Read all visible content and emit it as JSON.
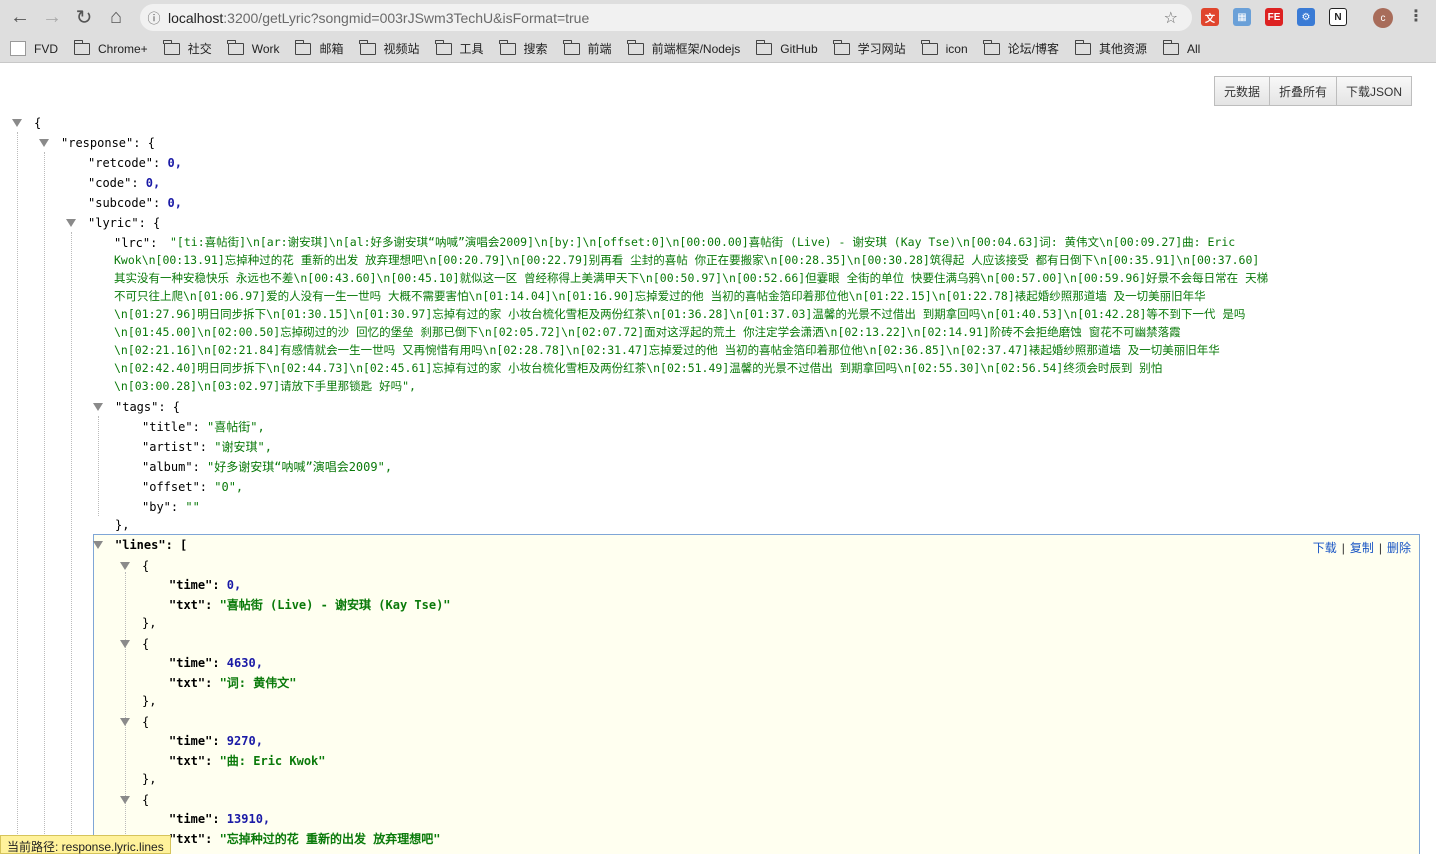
{
  "browser": {
    "url_host": "localhost",
    "url_path": ":3200/getLyric?songmid=003rJSwm3TechU&isFormat=true",
    "avatar_letter": "c"
  },
  "bookmarks": [
    "FVD",
    "Chrome+",
    "社交",
    "Work",
    "邮箱",
    "视频站",
    "工具",
    "搜索",
    "前端",
    "前端框架/Nodejs",
    "GitHub",
    "学习网站",
    "icon",
    "论坛/博客",
    "其他资源",
    "All"
  ],
  "viewer_buttons": [
    "元数据",
    "折叠所有",
    "下载JSON"
  ],
  "json": {
    "open_brace": "{",
    "response_key": "\"response\": {",
    "retcode_key": "\"retcode\": ",
    "retcode_val": "0,",
    "code_key": "\"code\": ",
    "code_val": "0,",
    "subcode_key": "\"subcode\": ",
    "subcode_val": "0,",
    "lyric_key": "\"lyric\": {",
    "lrc_key": "\"lrc\": ",
    "lrc_lines": [
      "\"[ti:喜帖街]\\n[ar:谢安琪]\\n[al:好多谢安琪“呐喊”演唱会2009]\\n[by:]\\n[offset:0]\\n[00:00.00]喜帖街 (Live) - 谢安琪 (Kay Tse)\\n[00:04.63]词: 黄伟文\\n[00:09.27]曲: Eric",
      "Kwok\\n[00:13.91]忘掉种过的花 重新的出发 放弃理想吧\\n[00:20.79]\\n[00:22.79]别再看 尘封的喜帖 你正在要搬家\\n[00:28.35]\\n[00:30.28]筑得起 人应该接受 都有日倒下\\n[00:35.91]\\n[00:37.60]",
      "其实没有一种安稳快乐 永远也不差\\n[00:43.60]\\n[00:45.10]就似这一区 曾经称得上美满甲天下\\n[00:50.97]\\n[00:52.66]但霎眼 全街的单位 快要住满乌鸦\\n[00:57.00]\\n[00:59.96]好景不会每日常在 天梯",
      "不可只往上爬\\n[01:06.97]爱的人没有一生一世吗 大概不需要害怕\\n[01:14.04]\\n[01:16.90]忘掉爱过的他 当初的喜帖金箔印着那位他\\n[01:22.15]\\n[01:22.78]裱起婚纱照那道墙 及一切美丽旧年华",
      "\\n[01:27.96]明日同步拆下\\n[01:30.15]\\n[01:30.97]忘掉有过的家 小妆台梳化雪柜及两份红茶\\n[01:36.28]\\n[01:37.03]温馨的光景不过借出 到期拿回吗\\n[01:40.53]\\n[01:42.28]等不到下一代 是吗",
      "\\n[01:45.00]\\n[02:00.50]忘掉砌过的沙 回忆的堡垒 刹那已倒下\\n[02:05.72]\\n[02:07.72]面对这浮起的荒土 你注定学会潇洒\\n[02:13.22]\\n[02:14.91]阶砖不会拒绝磨蚀 窗花不可幽禁落霞",
      "\\n[02:21.16]\\n[02:21.84]有感情就会一生一世吗 又再惋惜有用吗\\n[02:28.78]\\n[02:31.47]忘掉爱过的他 当初的喜帖金箔印着那位他\\n[02:36.85]\\n[02:37.47]裱起婚纱照那道墙 及一切美丽旧年华",
      "\\n[02:42.40]明日同步拆下\\n[02:44.73]\\n[02:45.61]忘掉有过的家 小妆台梳化雪柜及两份红茶\\n[02:51.49]温馨的光景不过借出 到期拿回吗\\n[02:55.30]\\n[02:56.54]终须会时辰到 别怕",
      "\\n[03:00.28]\\n[03:02.97]请放下手里那锁匙 好吗\","
    ],
    "tags_key": "\"tags\": {",
    "tags": [
      {
        "key": "\"title\": ",
        "val": "\"喜帖街\","
      },
      {
        "key": "\"artist\": ",
        "val": "\"谢安琪\","
      },
      {
        "key": "\"album\": ",
        "val": "\"好多谢安琪“呐喊”演唱会2009\","
      },
      {
        "key": "\"offset\": ",
        "val": "\"0\","
      },
      {
        "key": "\"by\": ",
        "val": "\"\""
      }
    ],
    "tags_close": "},",
    "lines_key": "\"lines\": [",
    "lines_actions": [
      "下载",
      "复制",
      "删除"
    ],
    "lines": [
      {
        "open": "{",
        "time_key": "\"time\": ",
        "time": "0,",
        "txt_key": "\"txt\": ",
        "txt": "\"喜帖街 (Live) - 谢安琪 (Kay Tse)\"",
        "close": "},"
      },
      {
        "open": "{",
        "time_key": "\"time\": ",
        "time": "4630,",
        "txt_key": "\"txt\": ",
        "txt": "\"词: 黄伟文\"",
        "close": "},"
      },
      {
        "open": "{",
        "time_key": "\"time\": ",
        "time": "9270,",
        "txt_key": "\"txt\": ",
        "txt": "\"曲: Eric Kwok\"",
        "close": "},"
      },
      {
        "open": "{",
        "time_key": "\"time\": ",
        "time": "13910,",
        "txt_key": "\"txt\": ",
        "txt": "\"忘掉种过的花 重新的出发 放弃理想吧\"",
        "close": ""
      }
    ]
  },
  "status_bar": "当前路径: response.lyric.lines"
}
